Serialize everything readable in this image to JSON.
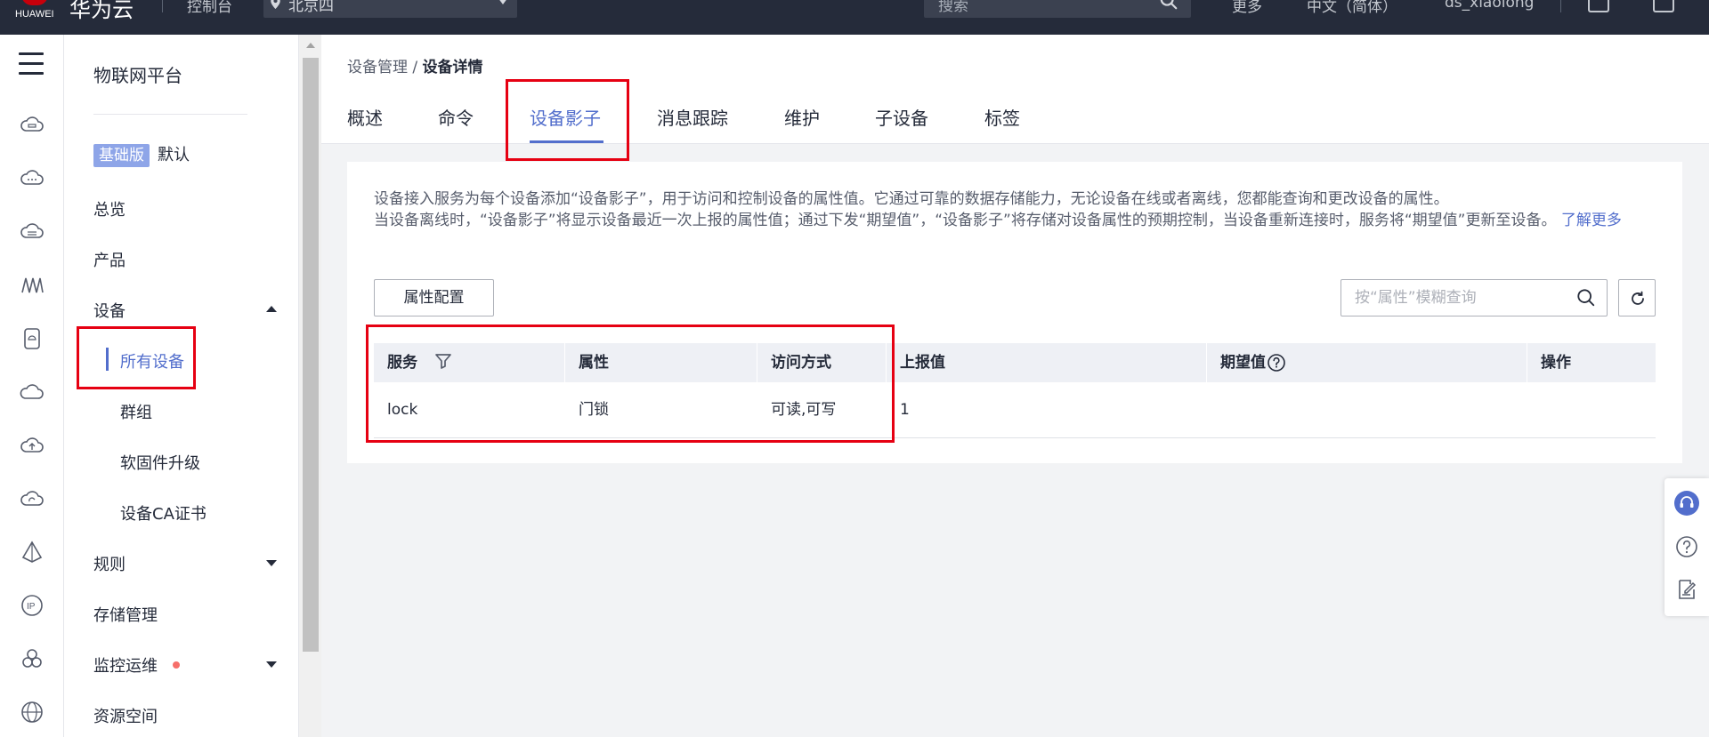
{
  "topbar": {
    "brand": "HUAWEI",
    "cloud_name": "华为云",
    "console": "控制台",
    "region": "北京四",
    "search_placeholder": "搜索",
    "more": "更多",
    "language": "中文（简体）",
    "username": "ds_xiaolong"
  },
  "rail": {
    "icons": [
      "menu-icon",
      "cloud-server-icon",
      "cloud-chat-icon",
      "cloud-database-icon",
      "waveform-icon",
      "device-icon",
      "cloud-icon",
      "cloud-upload-icon",
      "cloud-refresh-icon",
      "pyramid-icon",
      "ip-icon",
      "cluster-icon",
      "globe-icon"
    ]
  },
  "subnav": {
    "title": "物联网平台",
    "badge": "基础版",
    "badge_default": "默认",
    "items": {
      "overview": "总览",
      "products": "产品",
      "devices": "设备",
      "all_devices": "所有设备",
      "groups": "群组",
      "firmware": "软固件升级",
      "ca_cert": "设备CA证书",
      "rules": "规则",
      "storage": "存储管理",
      "monitor": "监控运维",
      "resource_space": "资源空间"
    }
  },
  "breadcrumb": {
    "parent": "设备管理",
    "separator": " / ",
    "current": "设备详情"
  },
  "tabs": [
    "概述",
    "命令",
    "设备影子",
    "消息跟踪",
    "维护",
    "子设备",
    "标签"
  ],
  "active_tab": "设备影子",
  "panel": {
    "desc_line1": "设备接入服务为每个设备添加“设备影子”，用于访问和控制设备的属性值。它通过可靠的数据存储能力，无论设备在线或者离线，您都能查询和更改设备的属性。",
    "desc_line2": "当设备离线时，“设备影子”将显示设备最近一次上报的属性值；通过下发“期望值”，“设备影子”将存储对设备属性的预期控制，当设备重新连接时，服务将“期望值”更新至设备。",
    "learn_more": "了解更多",
    "config_button": "属性配置",
    "search_placeholder": "按“属性”模糊查询"
  },
  "table": {
    "headers": {
      "service": "服务",
      "property": "属性",
      "access": "访问方式",
      "reported": "上报值",
      "desired": "期望值",
      "actions": "操作"
    },
    "rows": [
      {
        "service": "lock",
        "property": "门锁",
        "access": "可读,可写",
        "reported": "1",
        "desired": "",
        "actions": ""
      }
    ]
  },
  "colors": {
    "topbar_bg": "#252b3a",
    "accent": "#526ecc",
    "annotation_red": "#e60012",
    "badge_bg": "#8ea5e8",
    "page_bg": "#f2f3f5"
  }
}
